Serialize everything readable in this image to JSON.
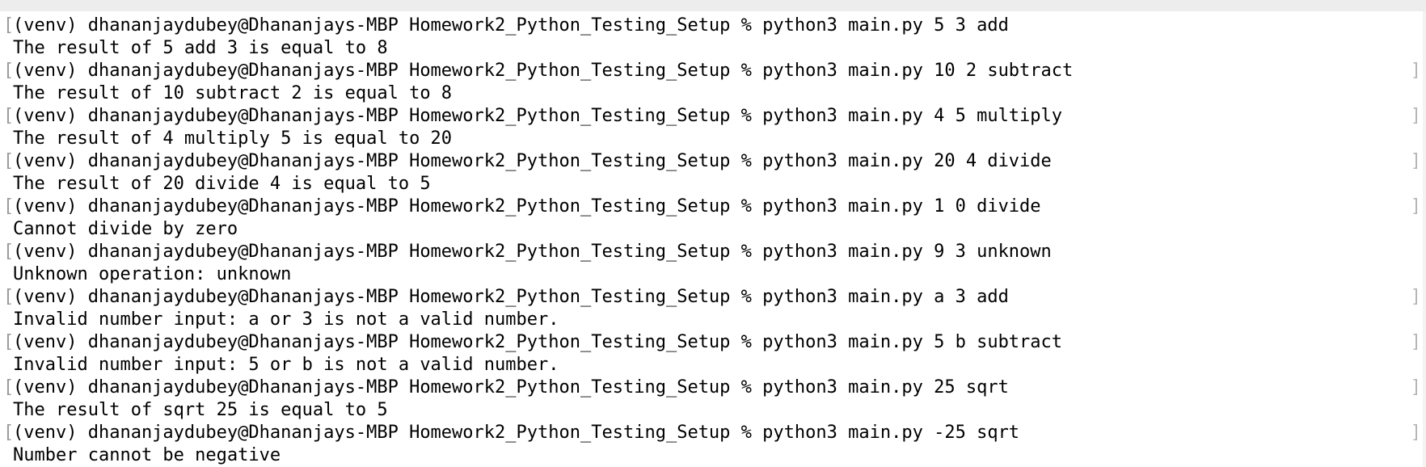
{
  "terminal": {
    "prompt": "(venv) dhananjaydubey@Dhananjays-MBP Homework2_Python_Testing_Setup % ",
    "sessions": [
      {
        "command": "python3 main.py 5 3 add",
        "output": "The result of 5 add 3 is equal to 8"
      },
      {
        "command": "python3 main.py 10 2 subtract",
        "output": "The result of 10 subtract 2 is equal to 8"
      },
      {
        "command": "python3 main.py 4 5 multiply",
        "output": "The result of 4 multiply 5 is equal to 20"
      },
      {
        "command": "python3 main.py 20 4 divide",
        "output": "The result of 20 divide 4 is equal to 5"
      },
      {
        "command": "python3 main.py 1 0 divide",
        "output": "Cannot divide by zero"
      },
      {
        "command": "python3 main.py 9 3 unknown",
        "output": "Unknown operation: unknown"
      },
      {
        "command": "python3 main.py a 3 add",
        "output": "Invalid number input: a or 3 is not a valid number."
      },
      {
        "command": "python3 main.py 5 b subtract",
        "output": "Invalid number input: 5 or b is not a valid number."
      },
      {
        "command": "python3 main.py 25 sqrt",
        "output": "The result of sqrt 25 is equal to 5"
      },
      {
        "command": "python3 main.py -25 sqrt",
        "output": "Number cannot be negative"
      }
    ]
  }
}
